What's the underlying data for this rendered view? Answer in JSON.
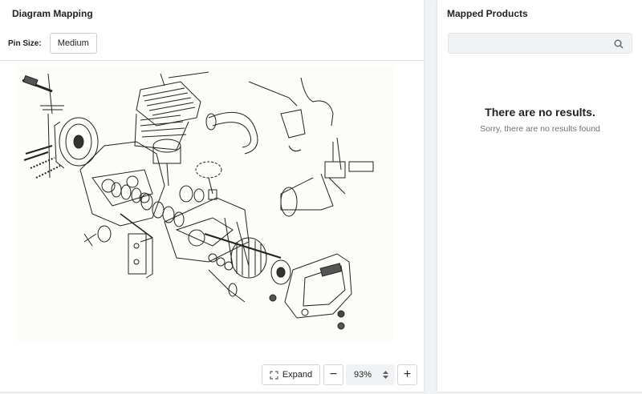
{
  "diagram_panel": {
    "title": "Diagram Mapping",
    "pin_size_label": "Pin Size:",
    "pin_size_value": "Medium",
    "image_alt": "Exploded engine parts diagram"
  },
  "zoom_controls": {
    "expand_label": "Expand",
    "minus_label": "−",
    "zoom_value": "93%",
    "plus_label": "+"
  },
  "products_panel": {
    "title": "Mapped Products",
    "search_placeholder": "",
    "empty_title": "There are no results.",
    "empty_message": "Sorry, there are no results found"
  },
  "icons": {
    "expand": "expand-arrows-icon",
    "search": "search-icon",
    "zoom_stepper": "up-down-chevron-icon"
  }
}
